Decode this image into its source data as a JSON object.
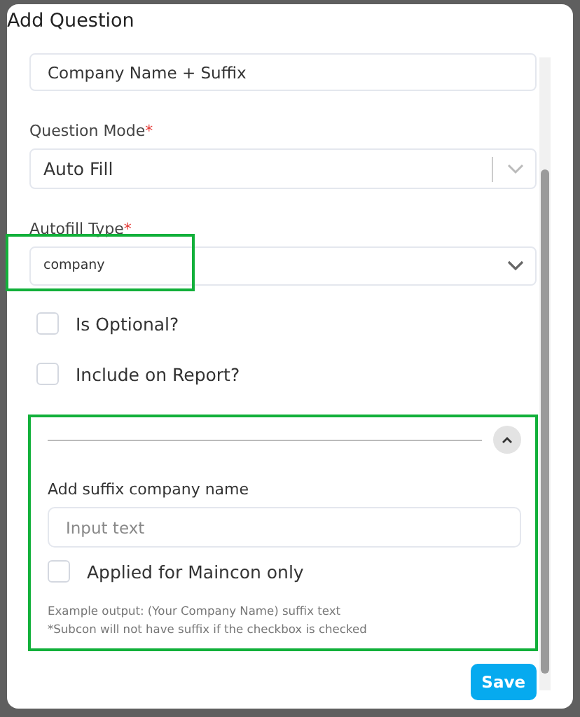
{
  "dialog": {
    "title": "Add Question"
  },
  "question_field": {
    "value": "Company Name + Suffix"
  },
  "question_mode": {
    "label": "Question Mode",
    "required_mark": "*",
    "value": "Auto Fill"
  },
  "autofill_type": {
    "label": "Autofill Type",
    "required_mark": "*",
    "value": "company",
    "highlighted": true
  },
  "options": [
    {
      "label": "Is Optional?",
      "checked": false
    },
    {
      "label": "Include on Report?",
      "checked": false
    }
  ],
  "suffix_section": {
    "highlighted": true,
    "expanded": true,
    "label": "Add suffix company name",
    "placeholder": "Input text",
    "maincon_option": {
      "label": "Applied for Maincon only",
      "checked": false
    },
    "help_lines": [
      "Example output: (Your Company Name) suffix text",
      "*Subcon will not have suffix if the checkbox is checked"
    ]
  },
  "buttons": [
    {
      "label": "Save",
      "kind": "primary"
    }
  ]
}
